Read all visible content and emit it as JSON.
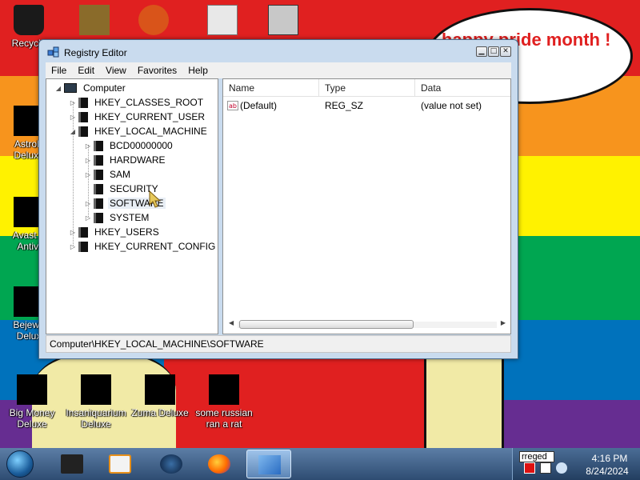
{
  "colors": {
    "stripe_red": "#e02020",
    "stripe_orange": "#f7941d",
    "stripe_yellow": "#fff200",
    "stripe_green": "#00a651",
    "stripe_blue": "#0072bc",
    "stripe_purple": "#662d91",
    "window_frame": "#c9dbee",
    "taskbar": "#2e4c72"
  },
  "desktop": {
    "speech_bubble": "happy pride month !",
    "icons": [
      {
        "label": "Recycle",
        "icon": "recycle-bin-icon"
      },
      {
        "label": "AstroP\nDeluxe",
        "icon": "astropop-icon"
      },
      {
        "label": "Avast F\nAntivi",
        "icon": "avast-icon"
      },
      {
        "label": "Bejewe\nDelux",
        "icon": "bejeweled-icon"
      },
      {
        "label": "Big Money\nDeluxe",
        "icon": "big-money-icon"
      },
      {
        "label": "Insaniquarium\nDeluxe",
        "icon": "insaniquarium-icon"
      },
      {
        "label": "Zuma Deluxe",
        "icon": "zuma-icon"
      },
      {
        "label": "some russian\nran a rat",
        "icon": "document-icon"
      }
    ]
  },
  "window": {
    "title": "Registry Editor",
    "menu": [
      "File",
      "Edit",
      "View",
      "Favorites",
      "Help"
    ],
    "tree": {
      "root": "Computer",
      "items": [
        {
          "label": "HKEY_CLASSES_ROOT",
          "depth": 1,
          "expander": "▷"
        },
        {
          "label": "HKEY_CURRENT_USER",
          "depth": 1,
          "expander": "▷"
        },
        {
          "label": "HKEY_LOCAL_MACHINE",
          "depth": 1,
          "expander": "◢"
        },
        {
          "label": "BCD00000000",
          "depth": 2,
          "expander": "▷"
        },
        {
          "label": "HARDWARE",
          "depth": 2,
          "expander": "▷"
        },
        {
          "label": "SAM",
          "depth": 2,
          "expander": "▷"
        },
        {
          "label": "SECURITY",
          "depth": 2,
          "expander": ""
        },
        {
          "label": "SOFTWARE",
          "depth": 2,
          "expander": "▷",
          "selected": true
        },
        {
          "label": "SYSTEM",
          "depth": 2,
          "expander": "▷"
        },
        {
          "label": "HKEY_USERS",
          "depth": 1,
          "expander": "▷"
        },
        {
          "label": "HKEY_CURRENT_CONFIG",
          "depth": 1,
          "expander": "▷"
        }
      ]
    },
    "list": {
      "columns": [
        "Name",
        "Type",
        "Data"
      ],
      "rows": [
        {
          "name": "(Default)",
          "type": "REG_SZ",
          "data": "(value not set)",
          "icon": "string-value-icon"
        }
      ]
    },
    "status": "Computer\\HKEY_LOCAL_MACHINE\\SOFTWARE"
  },
  "taskbar": {
    "tray_tooltip": "rreged",
    "time": "4:16 PM",
    "date": "8/24/2024",
    "pinned": [
      "windows-explorer-icon",
      "media-player-icon",
      "globe-icon",
      "firefox-icon",
      "regedit-icon"
    ]
  }
}
